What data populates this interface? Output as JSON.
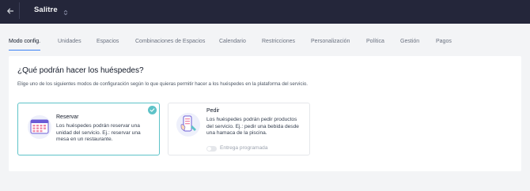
{
  "header": {
    "title": "Salitre",
    "back_icon": "arrow-left-icon",
    "switch_icon": "chevron-updown-icon"
  },
  "tabs": [
    {
      "label": "Modo config.",
      "active": true
    },
    {
      "label": "Unidades",
      "active": false
    },
    {
      "label": "Espacios",
      "active": false
    },
    {
      "label": "Combinaciones de Espacios",
      "active": false
    },
    {
      "label": "Calendario",
      "active": false
    },
    {
      "label": "Restricciones",
      "active": false
    },
    {
      "label": "Personalización",
      "active": false
    },
    {
      "label": "Política",
      "active": false
    },
    {
      "label": "Gestión",
      "active": false
    },
    {
      "label": "Pagos",
      "active": false
    }
  ],
  "main": {
    "heading": "¿Qué podrán hacer los huéspedes?",
    "subtext": "Elige uno de los siguientes modos de configuración según lo que quieras permitir hacer a los huéspedes en la plataforma del servicio.",
    "options": [
      {
        "title": "Reservar",
        "desc_lines": [
          "Los huéspedes podrán reservar una",
          "unidad del servicio. Ej.: reservar una",
          "mesa en un restaurante."
        ],
        "selected": true,
        "icon": "calendar-grid-icon"
      },
      {
        "title": "Pedir",
        "desc_lines": [
          "Los huéspedes podrán pedir productos",
          "del servicio. Ej.: pedir una bebida desde",
          "una hamaca de la piscina."
        ],
        "selected": false,
        "icon": "phone-order-icon",
        "toggle_label": "Entrega programada",
        "toggle_on": false
      }
    ]
  },
  "colors": {
    "header_bg": "#24263a",
    "accent_teal": "#5ec3c8",
    "tab_underline": "#3b82f6",
    "page_bg": "#f3f4f6"
  }
}
